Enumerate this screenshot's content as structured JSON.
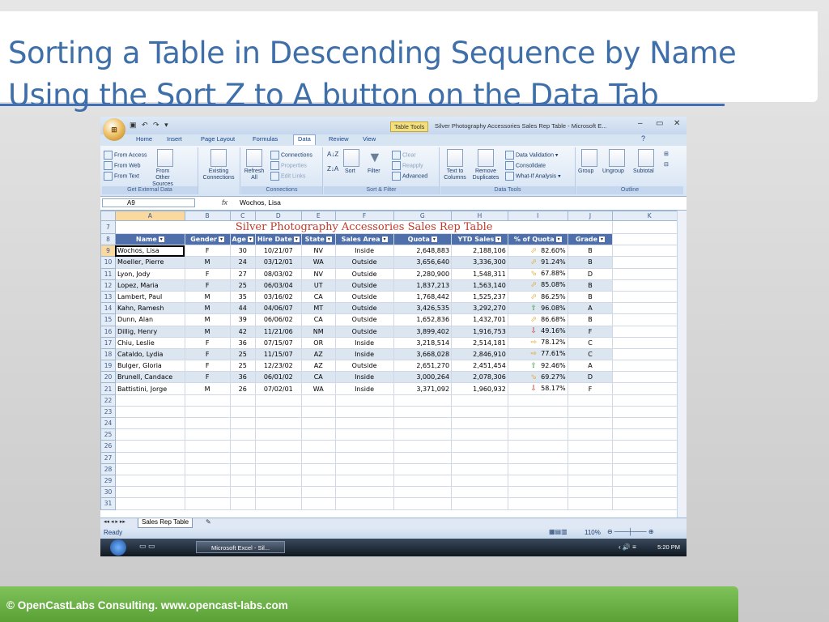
{
  "slide": {
    "title_line1": "Sorting a Table in Descending Sequence by Name",
    "title_line2": "Using the Sort Z to A button on the Data Tab",
    "footer": "© OpenCastLabs Consulting. www.opencast-labs.com"
  },
  "excel": {
    "context_tab": "Table Tools",
    "window_title": "Silver Photography Accessories Sales Rep Table - Microsoft E...",
    "tabs": [
      "Home",
      "Insert",
      "Page Layout",
      "Formulas",
      "Data",
      "Review",
      "View"
    ],
    "active_tab": "Data",
    "ribbon": {
      "get_external": {
        "label": "Get External Data",
        "from_access": "From Access",
        "from_web": "From Web",
        "from_text": "From Text",
        "from_other": "From Other Sources",
        "existing": "Existing Connections"
      },
      "connections": {
        "label": "Connections",
        "refresh": "Refresh All",
        "connections": "Connections",
        "properties": "Properties",
        "edit_links": "Edit Links"
      },
      "sort_filter": {
        "label": "Sort & Filter",
        "sort": "Sort",
        "filter": "Filter",
        "clear": "Clear",
        "reapply": "Reapply",
        "advanced": "Advanced"
      },
      "data_tools": {
        "label": "Data Tools",
        "text_to_columns": "Text to Columns",
        "remove_duplicates": "Remove Duplicates",
        "data_validation": "Data Validation",
        "consolidate": "Consolidate",
        "what_if": "What-If Analysis"
      },
      "outline": {
        "label": "Outline",
        "group": "Group",
        "ungroup": "Ungroup",
        "subtotal": "Subtotal"
      }
    },
    "name_box": "A9",
    "formula": "Wochos, Lisa",
    "columns": [
      "A",
      "B",
      "C",
      "D",
      "E",
      "F",
      "G",
      "H",
      "I",
      "J",
      "K"
    ],
    "sheet_title": "Silver Photography Accessories Sales Rep Table",
    "headers": [
      "Name",
      "Gender",
      "Age",
      "Hire Date",
      "State",
      "Sales Area",
      "Quota",
      "YTD Sales",
      "% of Quota",
      "Grade"
    ],
    "rows": [
      [
        "Wochos, Lisa",
        "F",
        "30",
        "10/21/07",
        "NV",
        "Inside",
        "2,648,883",
        "2,188,106",
        "82.60%",
        "B"
      ],
      [
        "Moeller, Pierre",
        "M",
        "24",
        "03/12/01",
        "WA",
        "Outside",
        "3,656,640",
        "3,336,300",
        "91.24%",
        "B"
      ],
      [
        "Lyon, Jody",
        "F",
        "27",
        "08/03/02",
        "NV",
        "Outside",
        "2,280,900",
        "1,548,311",
        "67.88%",
        "D"
      ],
      [
        "Lopez, Maria",
        "F",
        "25",
        "06/03/04",
        "UT",
        "Outside",
        "1,837,213",
        "1,563,140",
        "85.08%",
        "B"
      ],
      [
        "Lambert, Paul",
        "M",
        "35",
        "03/16/02",
        "CA",
        "Outside",
        "1,768,442",
        "1,525,237",
        "86.25%",
        "B"
      ],
      [
        "Kahn, Ramesh",
        "M",
        "44",
        "04/06/07",
        "MT",
        "Outside",
        "3,426,535",
        "3,292,270",
        "96.08%",
        "A"
      ],
      [
        "Dunn, Alan",
        "M",
        "39",
        "06/06/02",
        "CA",
        "Outside",
        "1,652,836",
        "1,432,701",
        "86.68%",
        "B"
      ],
      [
        "Dillig, Henry",
        "M",
        "42",
        "11/21/06",
        "NM",
        "Outside",
        "3,899,402",
        "1,916,753",
        "49.16%",
        "F"
      ],
      [
        "Chiu, Leslie",
        "F",
        "36",
        "07/15/07",
        "OR",
        "Inside",
        "3,218,514",
        "2,514,181",
        "78.12%",
        "C"
      ],
      [
        "Cataldo, Lydia",
        "F",
        "25",
        "11/15/07",
        "AZ",
        "Inside",
        "3,668,028",
        "2,846,910",
        "77.61%",
        "C"
      ],
      [
        "Bulger, Gloria",
        "F",
        "25",
        "12/23/02",
        "AZ",
        "Outside",
        "2,651,270",
        "2,451,454",
        "92.46%",
        "A"
      ],
      [
        "Brunell, Candace",
        "F",
        "36",
        "06/01/02",
        "CA",
        "Inside",
        "3,000,264",
        "2,078,306",
        "69.27%",
        "D"
      ],
      [
        "Battistini, Jorge",
        "M",
        "26",
        "07/02/01",
        "WA",
        "Inside",
        "3,371,092",
        "1,960,932",
        "58.17%",
        "F"
      ]
    ],
    "icon_directions": [
      "diag-up",
      "diag-up",
      "diag-down",
      "diag-up",
      "diag-up",
      "up",
      "diag-up",
      "down",
      "right",
      "right",
      "up",
      "diag-down",
      "down"
    ],
    "empty_rows": [
      "22",
      "23",
      "24",
      "25",
      "26",
      "27",
      "28",
      "29",
      "30",
      "31"
    ],
    "sheet_tab": "Sales Rep Table",
    "status": "Ready",
    "zoom": "110%",
    "taskbar_app": "Microsoft Excel - Sil...",
    "clock": "5:20 PM"
  },
  "colors": {
    "title": "#3f6fa9",
    "accent": "#4f6faa",
    "footer": "#5aa035",
    "sheet_title": "#c0392b"
  }
}
